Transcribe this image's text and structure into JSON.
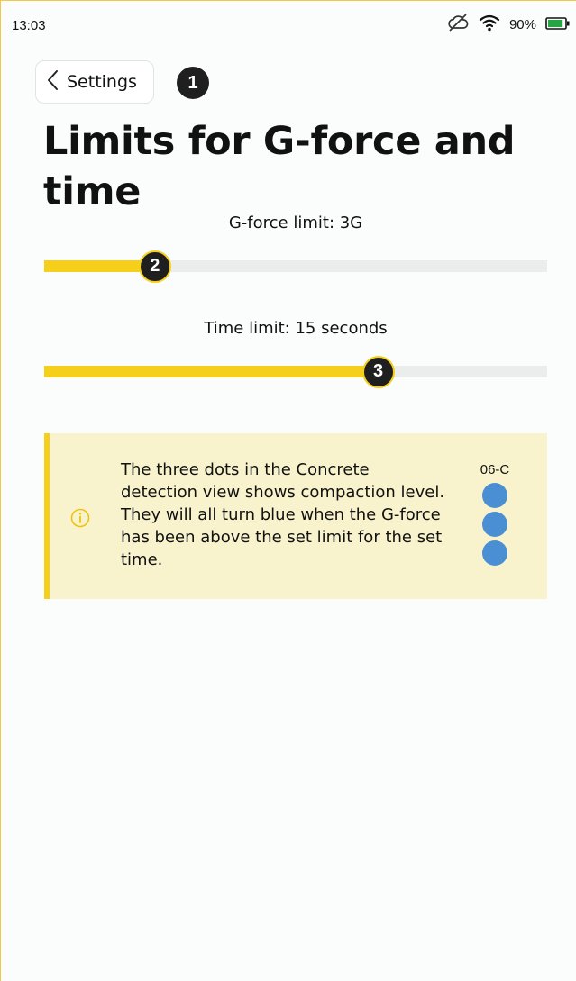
{
  "status_bar": {
    "time": "13:03",
    "battery_percent_text": "90%",
    "battery_level": 0.9,
    "icons": [
      "sync-off-icon",
      "wifi-icon",
      "battery-icon"
    ]
  },
  "header": {
    "back_label": "Settings",
    "title": "Limits for G-force and time"
  },
  "annotations": [
    "1",
    "2",
    "3"
  ],
  "sliders": {
    "gforce": {
      "label": "G-force limit: 3G",
      "fraction": 0.22
    },
    "time": {
      "label": "Time limit: 15 seconds",
      "fraction": 0.664
    }
  },
  "info": {
    "icon": "info-circle-icon",
    "text": "The three dots in the Concrete\ndetection view shows compaction level.\n They will all turn blue when the G-force\nhas been above the set limit for the set\ntime.",
    "dots_label": "06-C",
    "dot_count": 3
  },
  "colors": {
    "accent_yellow": "#f6cf1a",
    "info_background": "#f8f3cc",
    "dot_blue": "#4a8fd4",
    "battery_green": "#27a544",
    "badge_dark": "#1f1f1f"
  }
}
